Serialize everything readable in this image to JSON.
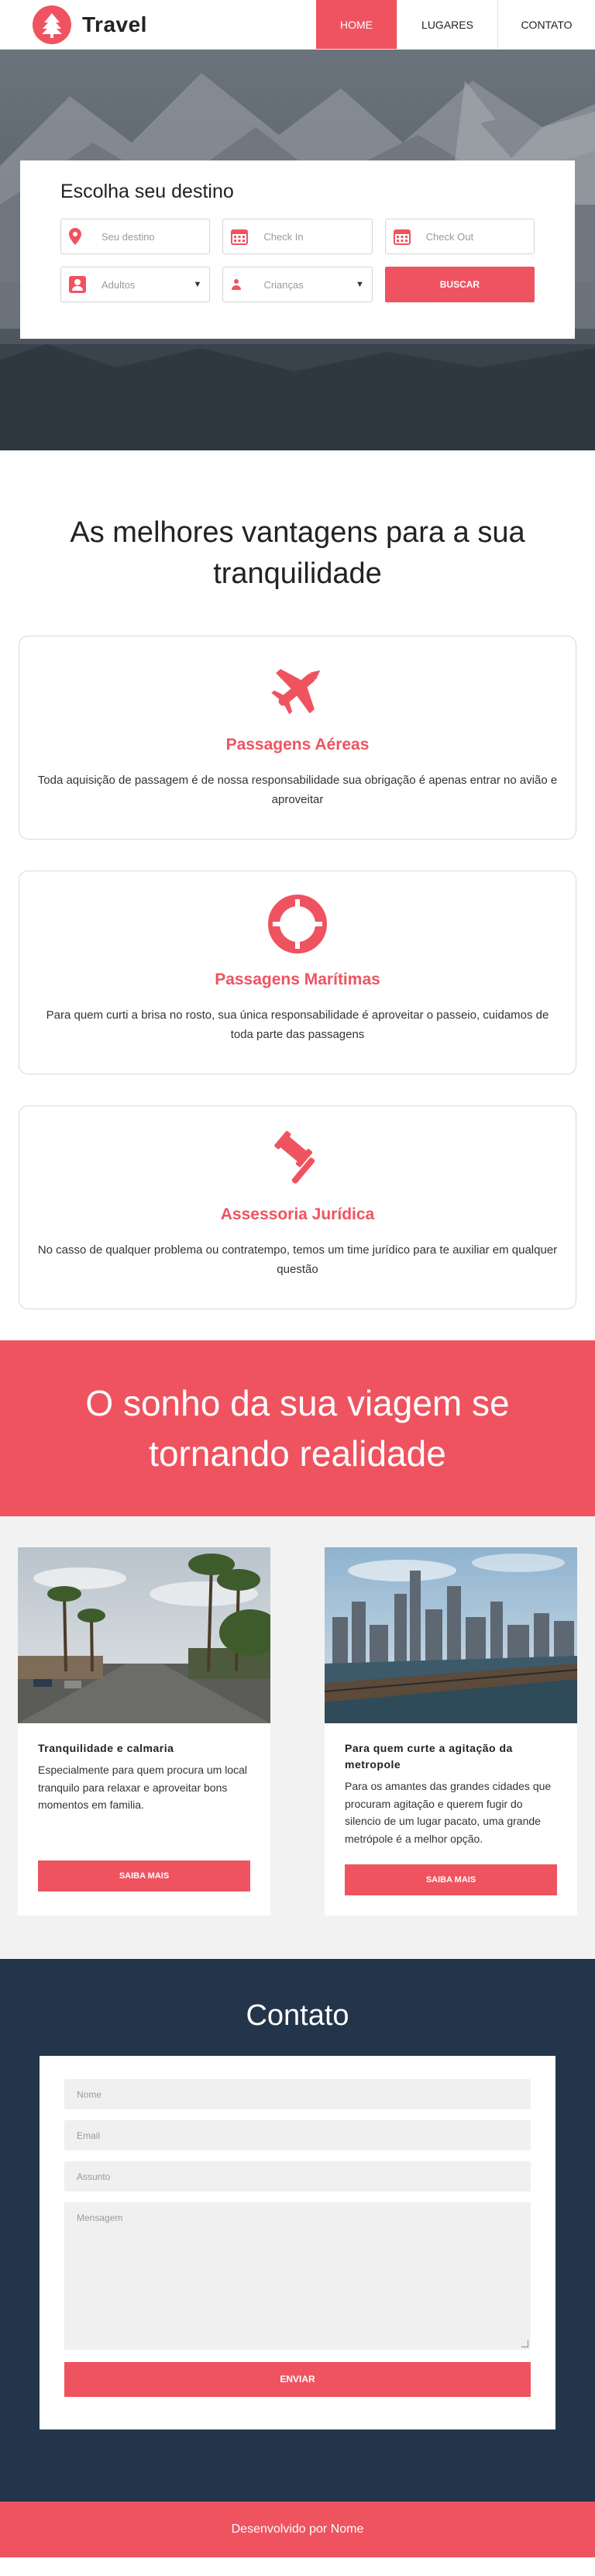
{
  "brand": {
    "name": "Travel",
    "logo_icon": "tree-icon"
  },
  "nav": {
    "items": [
      {
        "label": "Home"
      },
      {
        "label": "Lugares"
      },
      {
        "label": "Contato"
      }
    ]
  },
  "hero": {
    "search_title": "Escolha seu destino",
    "destination_placeholder": "Seu destino",
    "checkin_placeholder": "Check In",
    "checkout_placeholder": "Check Out",
    "adults_value": "Adultos",
    "children_value": "Crianças",
    "search_button": "Buscar"
  },
  "advantages": {
    "title": "As melhores vantagens para a sua tranquilidade",
    "cards": [
      {
        "icon": "airplane-icon",
        "title": "Passagens Aéreas",
        "text": "Toda aquisição de passagem é de nossa responsabilidade sua obrigação é apenas entrar no avião e aproveitar"
      },
      {
        "icon": "lifebuoy-icon",
        "title": "Passagens Marítimas",
        "text": "Para quem curti a brisa no rosto, sua única responsabilidade é aproveitar o passeio, cuidamos de toda parte das passagens"
      },
      {
        "icon": "gavel-icon",
        "title": "Assessoria Jurídica",
        "text": "No casso de qualquer problema ou contratempo, temos um time jurídico para te auxiliar em qualquer questão"
      }
    ]
  },
  "banner": {
    "title": "O sonho da sua viagem se tornando realidade"
  },
  "destinations": [
    {
      "title": "Tranquilidade e calmaria",
      "text": "Especialmente para quem procura um local tranquilo para relaxar e aproveitar bons momentos em familia.",
      "button": "Saiba mais"
    },
    {
      "title": "Para quem curte a agitação da metropole",
      "text": "Para os amantes das grandes cidades que procuram agitação e querem fugir do silencio de um lugar pacato, uma grande metrópole é a melhor opção.",
      "button": "Saiba mais"
    }
  ],
  "contact": {
    "title": "Contato",
    "name_placeholder": "Nome",
    "email_placeholder": "Email",
    "subject_placeholder": "Assunto",
    "message_placeholder": "Mensagem",
    "send_button": "Enviar"
  },
  "footer": {
    "text": "Desenvolvido por Nome"
  },
  "colors": {
    "accent": "#ef5360",
    "dark": "#22354a",
    "light_bg": "#f2f2f2"
  }
}
